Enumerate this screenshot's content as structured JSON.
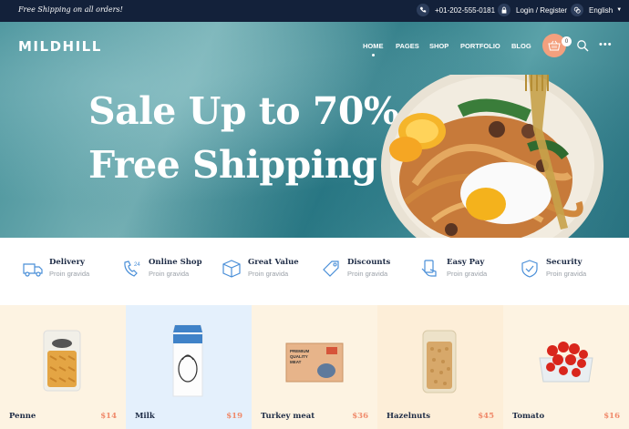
{
  "topbar": {
    "promo": "Free Shipping on all orders!",
    "phone": "+01-202-555-0181",
    "login": "Login / Register",
    "language": "English"
  },
  "header": {
    "logo": "MILDHILL",
    "nav": [
      "HOME",
      "PAGES",
      "SHOP",
      "PORTFOLIO",
      "BLOG"
    ],
    "cart_count": "0"
  },
  "hero": {
    "line1": "Sale Up to 70%",
    "line2": "Free Shipping"
  },
  "features": [
    {
      "title": "Delivery",
      "subtitle": "Proin gravida",
      "icon": "truck-icon"
    },
    {
      "title": "Online Shop",
      "subtitle": "Proin gravida",
      "icon": "phone-24-icon"
    },
    {
      "title": "Great Value",
      "subtitle": "Proin gravida",
      "icon": "box-icon"
    },
    {
      "title": "Discounts",
      "subtitle": "Proin gravida",
      "icon": "tag-icon"
    },
    {
      "title": "Easy Pay",
      "subtitle": "Proin gravida",
      "icon": "hand-card-icon"
    },
    {
      "title": "Security",
      "subtitle": "Proin gravida",
      "icon": "shield-check-icon"
    }
  ],
  "products": [
    {
      "name": "Penne",
      "price": "$14",
      "bg": "#fdf3e2"
    },
    {
      "name": "Milk",
      "price": "$19",
      "bg": "#e4f0fc"
    },
    {
      "name": "Turkey meat",
      "price": "$36",
      "bg": "#fdf3e2"
    },
    {
      "name": "Hazelnuts",
      "price": "$45",
      "bg": "#fdeed8"
    },
    {
      "name": "Tomato",
      "price": "$16",
      "bg": "#fdf3e2"
    }
  ],
  "colors": {
    "topbar": "#13213a",
    "accent": "#f3a07e",
    "price": "#f08a6b",
    "icon": "#4a8fd8"
  }
}
